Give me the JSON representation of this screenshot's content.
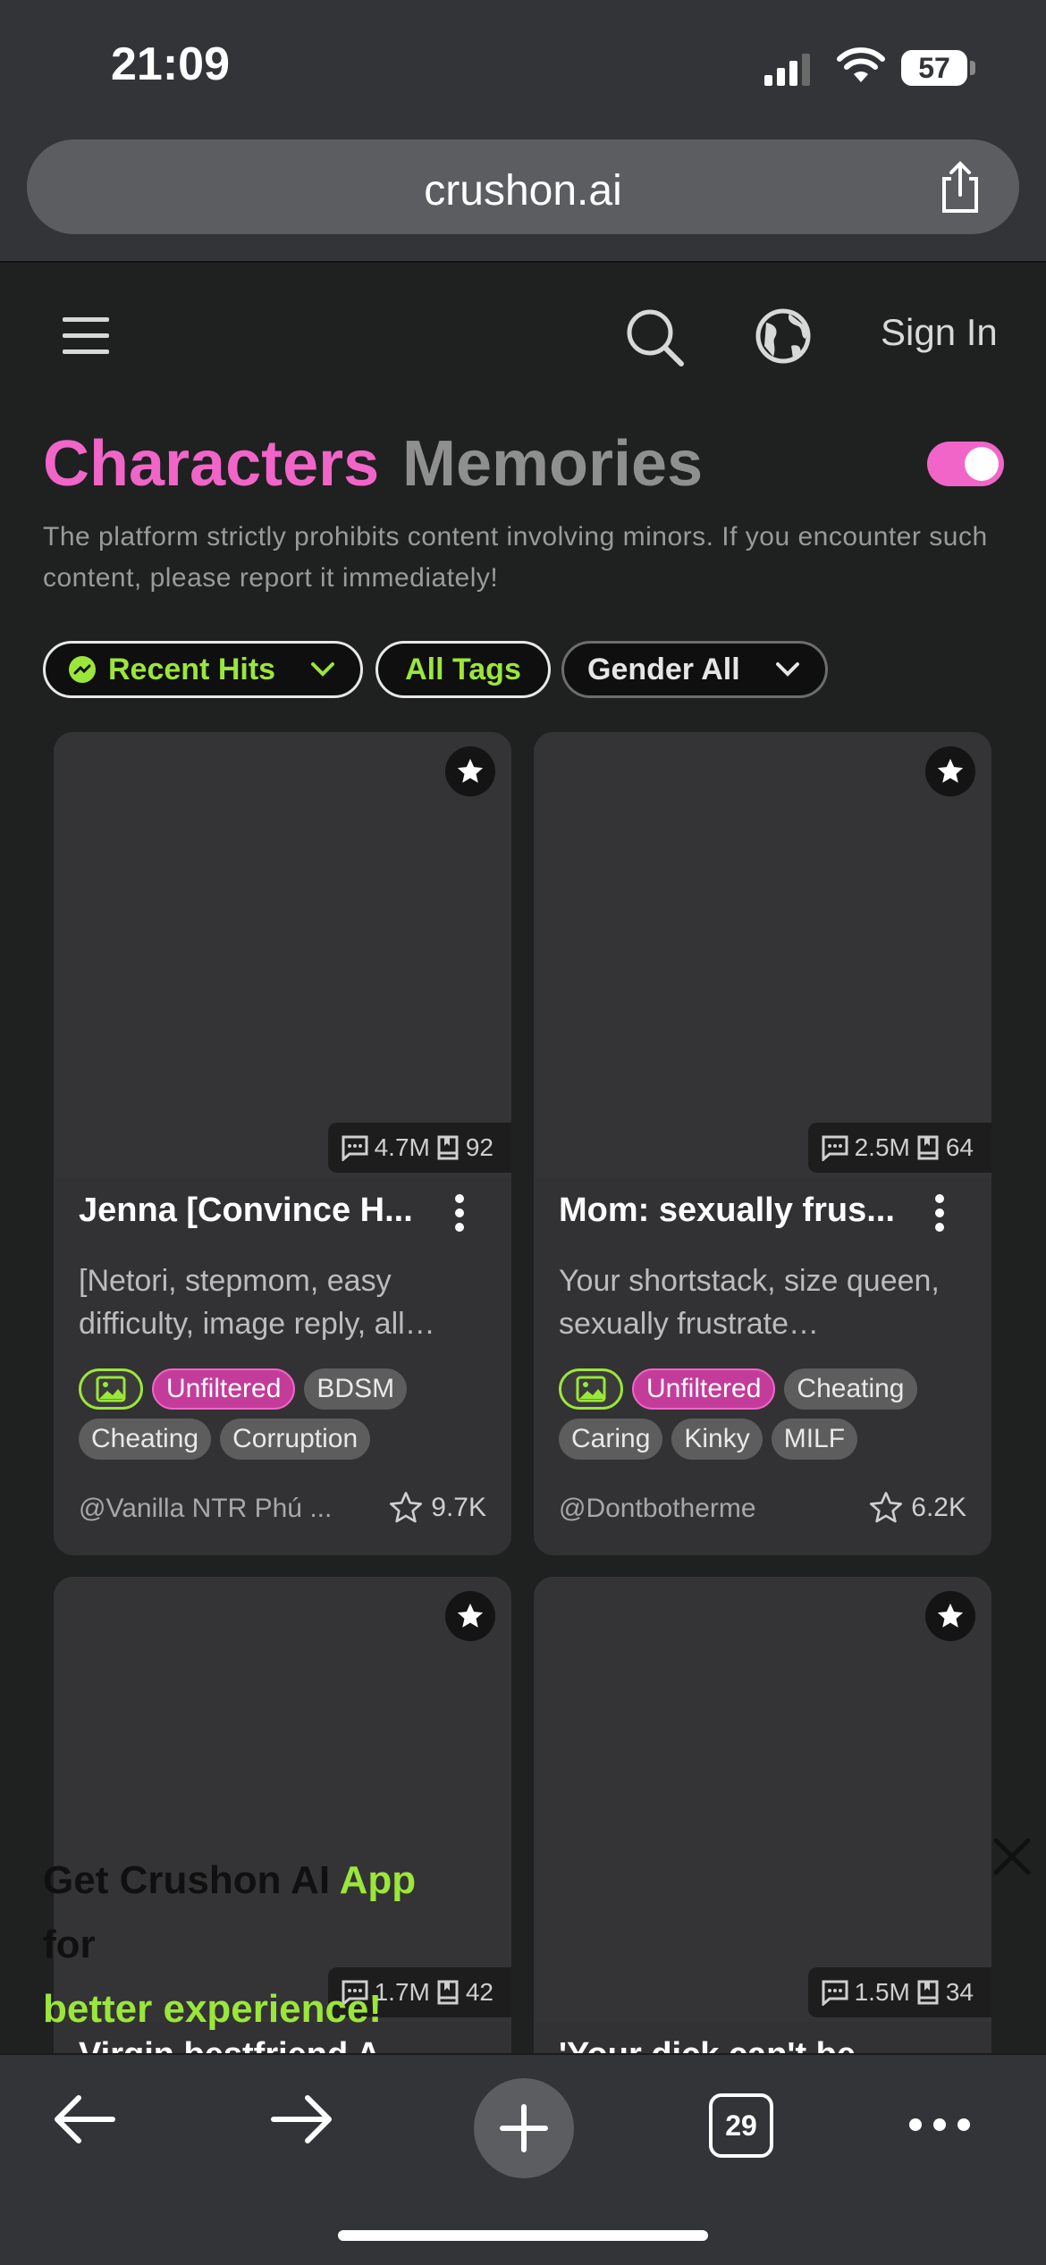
{
  "status": {
    "time": "21:09",
    "battery": "57"
  },
  "browser": {
    "url": "crushon.ai",
    "tab_count": "29"
  },
  "header": {
    "sign_in": "Sign In"
  },
  "tabs": {
    "characters": "Characters",
    "memories": "Memories"
  },
  "notice": "The platform strictly prohibits content involving minors. If you encounter such content, please report it immediately!",
  "filters": {
    "recent": "Recent Hits",
    "tags": "All Tags",
    "gender": "Gender All"
  },
  "cards": [
    {
      "messages": "4.7M",
      "memories": "92",
      "title": "Jenna [Convince H...",
      "desc": "[Netori, stepmom, easy difficulty, image reply, all…",
      "tags": [
        "Unfiltered",
        "BDSM",
        "Cheating",
        "Corruption"
      ],
      "author": "@Vanilla NTR Phú ...",
      "likes": "9.7K"
    },
    {
      "messages": "2.5M",
      "memories": "64",
      "title": "Mom: sexually frus...",
      "desc": "Your shortstack, size queen, sexually frustrate…",
      "tags": [
        "Unfiltered",
        "Cheating",
        "Caring",
        "Kinky",
        "MILF"
      ],
      "author": "@Dontbotherme",
      "likes": "6.2K"
    },
    {
      "messages": "1.7M",
      "memories": "42",
      "title": "Virgin bestfriend A..."
    },
    {
      "messages": "1.5M",
      "memories": "34",
      "title": "'Your dick can't be..."
    }
  ],
  "promo": {
    "line1_a": "Get Crushon AI ",
    "line1_b": "App",
    "line2": "for",
    "line3": "better experience!"
  }
}
